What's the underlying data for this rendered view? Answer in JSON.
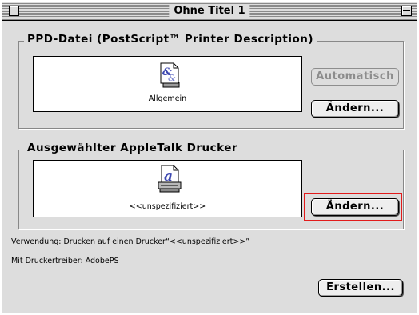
{
  "window": {
    "title": "Ohne Titel 1"
  },
  "ppd_group": {
    "title": "PPD-Datei (PostScript™ Printer Description)",
    "icon_name": "document-icon",
    "icon_label": "Allgemein",
    "auto_button": "Automatisch",
    "change_button": "Ändern..."
  },
  "printer_group": {
    "title": "Ausgewählter AppleTalk Drucker",
    "icon_name": "printer-icon",
    "icon_label": "<<unspezifiziert>>",
    "change_button": "Ändern..."
  },
  "info": {
    "usage": "Verwendung: Drucken auf einen Drucker“<<unspezifiziert>>”",
    "driver": "Mit Druckertreiber: AdobePS"
  },
  "footer": {
    "create_button": "Erstellen..."
  },
  "colors": {
    "highlight": "#e21b1b"
  }
}
